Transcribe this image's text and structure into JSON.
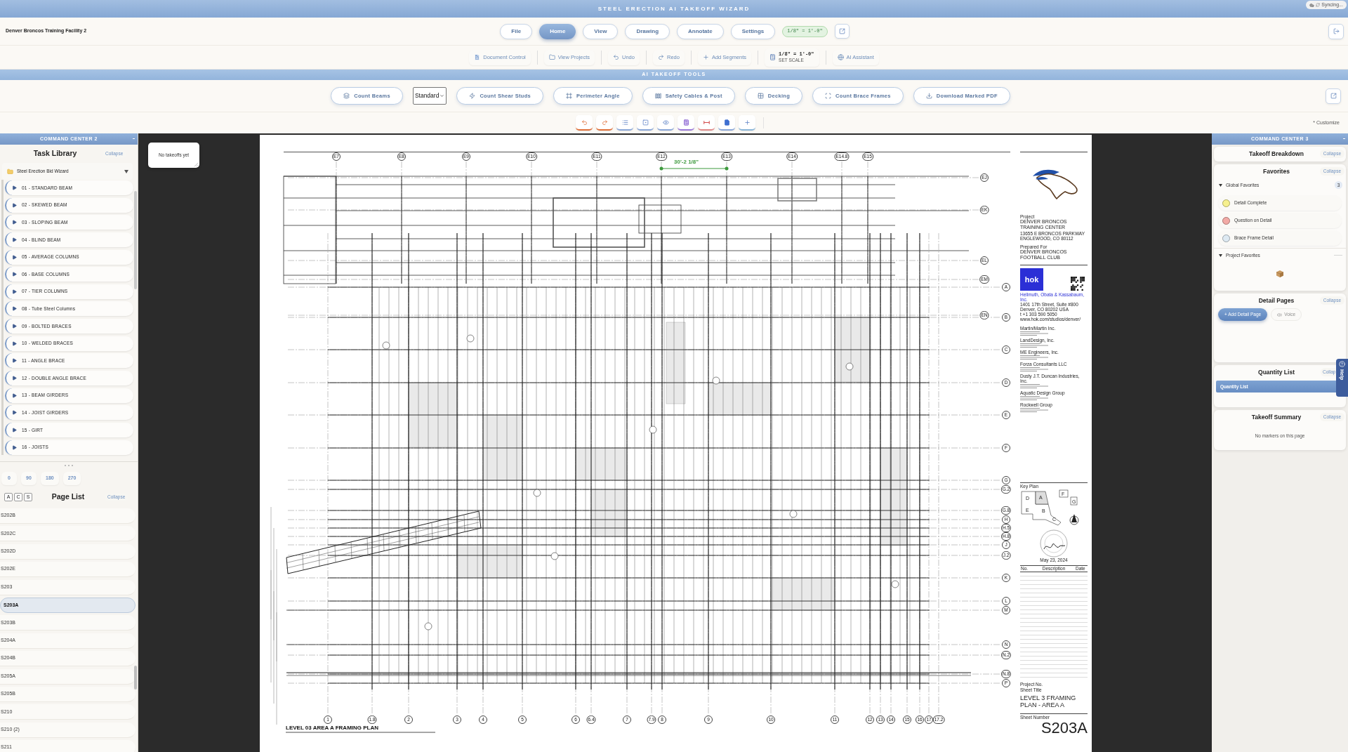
{
  "app": {
    "title": "STEEL ERECTION AI TAKEOFF WIZARD",
    "sync_status": "Syncing..."
  },
  "header": {
    "project_name": "Denver Broncos Training Facility 2",
    "menu": [
      {
        "label": "File",
        "selected": false
      },
      {
        "label": "Home",
        "selected": true
      },
      {
        "label": "View",
        "selected": false
      },
      {
        "label": "Drawing",
        "selected": false
      },
      {
        "label": "Annotate",
        "selected": false
      },
      {
        "label": "Settings",
        "selected": false
      }
    ],
    "scale_badge": "1/8\" = 1'-0\""
  },
  "toolbar": [
    {
      "kind": "button",
      "label": "Document Control"
    },
    {
      "kind": "button",
      "label": "View Projects"
    },
    {
      "kind": "button",
      "label": "Undo"
    },
    {
      "kind": "button",
      "label": "Redo"
    },
    {
      "kind": "button",
      "label": "Add Segments"
    },
    {
      "kind": "scale",
      "value": "1/8\" = 1'-0\"",
      "caption": "SET SCALE"
    },
    {
      "kind": "button",
      "label": "AI Assistant"
    }
  ],
  "ai_tools": {
    "title": "AI TAKEOFF TOOLS",
    "items": [
      {
        "kind": "button",
        "label": "Count Beams"
      },
      {
        "kind": "select",
        "value": "Standard"
      },
      {
        "kind": "button",
        "label": "Count Shear Studs"
      },
      {
        "kind": "button",
        "label": "Perimeter Angle"
      },
      {
        "kind": "button",
        "label": "Safety Cables & Post"
      },
      {
        "kind": "button",
        "label": "Decking"
      },
      {
        "kind": "button",
        "label": "Count Brace Frames"
      },
      {
        "kind": "button",
        "label": "Download Marked PDF"
      }
    ]
  },
  "quick_tools": {
    "customize": "* Customize"
  },
  "left_panel": {
    "title": "COMMAND CENTER 2",
    "task_library": {
      "title": "Task Library",
      "collapse": "Collapse",
      "folder": {
        "label": "Steel Erection Bid Wizard",
        "expanded": true
      },
      "tasks": [
        "01 - STANDARD BEAM",
        "02 - SKEWED BEAM",
        "03 - SLOPING BEAM",
        "04 - BLIND BEAM",
        "05 - AVERAGE COLUMNS",
        "06 - BASE COLUMNS",
        "07 - TIER COLUMNS",
        "08 - Tube Steel Columns",
        "09 - BOLTED BRACES",
        "10 - WELDED BRACES",
        "11 - ANGLE BRACE",
        "12 - DOUBLE ANGLE BRACE",
        "13 - BEAM GIRDERS",
        "14 - JOIST GIRDERS",
        "15 - GIRT",
        "16 - JOISTS"
      ]
    },
    "rotations": [
      "0",
      "90",
      "180",
      "270"
    ],
    "page_list": {
      "filters": [
        "A",
        "C",
        "S"
      ],
      "title": "Page List",
      "collapse": "Collapse",
      "pages": [
        {
          "label": "S202B",
          "selected": false
        },
        {
          "label": "S202C",
          "selected": false
        },
        {
          "label": "S202D",
          "selected": false
        },
        {
          "label": "S202E",
          "selected": false
        },
        {
          "label": "S203",
          "selected": false
        },
        {
          "label": "S203A",
          "selected": true
        },
        {
          "label": "S203B",
          "selected": false
        },
        {
          "label": "S204A",
          "selected": false
        },
        {
          "label": "S204B",
          "selected": false
        },
        {
          "label": "S205A",
          "selected": false
        },
        {
          "label": "S205B",
          "selected": false
        },
        {
          "label": "S210",
          "selected": false
        },
        {
          "label": "S210 (2)",
          "selected": false
        },
        {
          "label": "S211",
          "selected": false
        }
      ]
    }
  },
  "canvas": {
    "takeoffs_note": "No takeoffs yet",
    "sheet": {
      "dimension": "30'-2 1/8\"",
      "top_grid": [
        "E7",
        "E8",
        "E9",
        "E10",
        "E11",
        "E12",
        "E13",
        "E14",
        "E14.8",
        "E15"
      ],
      "upper_row_grid": [
        "EJ",
        "EK",
        "EL",
        "EM",
        "EN"
      ],
      "row_grid": [
        "A",
        "B",
        "C",
        "D",
        "E",
        "F",
        "G",
        "G.2",
        "G.8",
        "H",
        "H.5",
        "H.8",
        "J",
        "J.2",
        "K",
        "L",
        "M",
        "N",
        "N.2",
        "N.8",
        "P"
      ],
      "bottom_grid": [
        "1",
        "1.8",
        "2",
        "3",
        "4",
        "5",
        "6",
        "6.4",
        "7",
        "7.9",
        "8",
        "9",
        "10",
        "11",
        "12",
        "13",
        "14",
        "15",
        "16",
        "17",
        "17.2"
      ],
      "plan_title": "LEVEL 03 AREA A FRAMING PLAN",
      "title_block": {
        "project_label": "Project",
        "project_name": "DENVER BRONCOS TRAINING CENTER",
        "project_address": [
          "13655 E BRONCOS PARKWAY",
          "ENGLEWOOD, CO 80112"
        ],
        "prepared_label": "Prepared For",
        "client": "DENVER BRONCOS FOOTBALL CLUB",
        "architect_logo": "hok",
        "architect": "Hellmuth, Obata & Kassabaum, Inc.",
        "architect_address": [
          "1401 17th Street, Suite #800",
          "Denver, CO 80202 USA",
          "t +1 303 590 5050",
          "www.hok.com/studios/denver/"
        ],
        "consultants": [
          "Martin/Martin Inc.",
          "LandDesign, Inc.",
          "ME Engineers, Inc.",
          "Forza Consultants LLC",
          "Dusty J.T. Duncan Industries, Inc.",
          "Aquatic Design Group",
          "Rockwell Group"
        ],
        "key_plan_label": "Key Plan",
        "key_plan_areas": [
          "D",
          "E",
          "A",
          "B",
          "C",
          "F",
          "G"
        ],
        "seal_date": "May 23, 2024",
        "revision_columns": [
          "No.",
          "Description",
          "Date"
        ],
        "project_no_label": "Project No.",
        "sheet_title_label": "Sheet Title",
        "sheet_title": "LEVEL 3 FRAMING PLAN - AREA A",
        "sheet_number_label": "Sheet Number",
        "sheet_number": "S203A"
      }
    }
  },
  "right_panel": {
    "title": "COMMAND CENTER 3",
    "takeoff_breakdown": {
      "title": "Takeoff Breakdown",
      "collapse": "Collapse"
    },
    "favorites": {
      "title": "Favorites",
      "collapse": "Collapse",
      "groups": [
        {
          "label": "Global Favorites",
          "expanded": true,
          "count": "3",
          "items": [
            {
              "label": "Detail Complete",
              "color": "#f6f08e"
            },
            {
              "label": "Question on Detail",
              "color": "#f2aaa6"
            },
            {
              "label": "Brace Frame Detail",
              "color": "#dde9f2"
            }
          ]
        },
        {
          "label": "Project Favorites",
          "expanded": true
        }
      ]
    },
    "detail_pages": {
      "title": "Detail Pages",
      "collapse": "Collapse",
      "add_button": "+ Add Detail Page",
      "voice_button": {
        "label": "Voice",
        "disabled": true
      }
    },
    "quantity_list": {
      "title": "Quantity List",
      "collapse": "Collap",
      "bar": "Quantity List"
    },
    "takeoff_summary": {
      "title": "Takeoff Summary",
      "collapse": "Collapse",
      "empty": "No markers on this page"
    },
    "help": "Help"
  }
}
